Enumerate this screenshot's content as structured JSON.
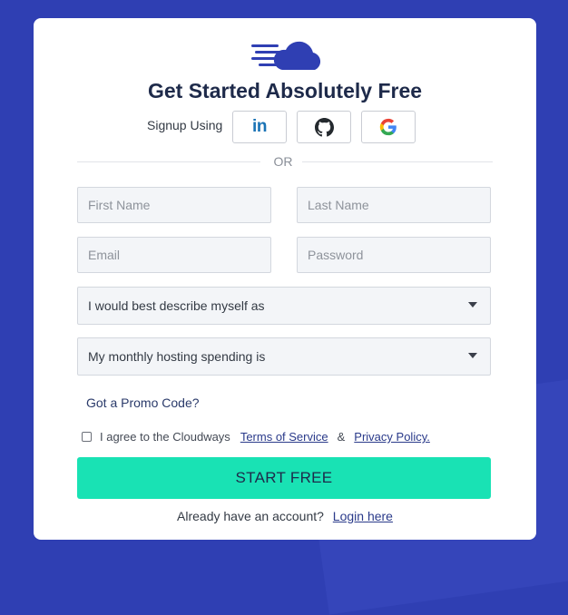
{
  "header": {
    "title": "Get Started Absolutely Free"
  },
  "social": {
    "label": "Signup Using",
    "linkedin_text": "in",
    "providers": [
      "linkedin-icon",
      "github-icon",
      "google-icon"
    ]
  },
  "divider": {
    "text": "OR"
  },
  "form": {
    "first_name_placeholder": "First Name",
    "last_name_placeholder": "Last Name",
    "email_placeholder": "Email",
    "password_placeholder": "Password",
    "describe_select": "I would best describe myself as",
    "spending_select": "My monthly hosting spending is",
    "promo_link": "Got a Promo Code?",
    "agree_text": "I agree to the Cloudways",
    "terms_link": "Terms of Service",
    "amp": "&",
    "privacy_link": "Privacy Policy.",
    "submit_label": "START FREE"
  },
  "footer": {
    "account_text": "Already have an account?",
    "login_link": "Login here"
  },
  "colors": {
    "background": "#2f3fb3",
    "brand_blue": "#2f3fb3",
    "cta": "#19e2b4",
    "heading": "#1e2a4a"
  }
}
